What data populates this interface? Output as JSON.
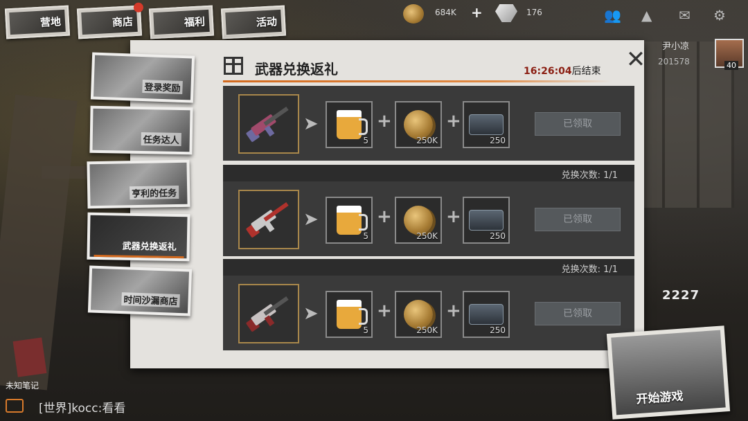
{
  "top_nav": [
    {
      "label": "营地",
      "badge": false
    },
    {
      "label": "商店",
      "badge": true
    },
    {
      "label": "福利",
      "badge": false
    },
    {
      "label": "活动",
      "badge": false
    }
  ],
  "resources": {
    "coins": "684K",
    "gems": "176"
  },
  "top_icons": [
    "friends-icon",
    "ranking-icon",
    "mail-icon",
    "settings-icon"
  ],
  "player": {
    "name": "尹小凉",
    "id": "201578",
    "level": "40",
    "power": "2227"
  },
  "side_menu": [
    {
      "label": "登录奖励",
      "active": false
    },
    {
      "label": "任务达人",
      "active": false
    },
    {
      "label": "亨利的任务",
      "active": false
    },
    {
      "label": "武器兑换返礼",
      "active": true
    },
    {
      "label": "时间沙漏商店",
      "active": false
    }
  ],
  "panel": {
    "title": "武器兑换返礼",
    "timer_value": "16:26:04",
    "timer_suffix": "后结束"
  },
  "rows": [
    {
      "count_label": "",
      "weapon": {
        "colors": [
          "#6d6aa0",
          "#a14a6b"
        ]
      },
      "rewards": [
        {
          "type": "beer",
          "qty": "5"
        },
        {
          "type": "coin",
          "qty": "250K"
        },
        {
          "type": "chest",
          "qty": "250"
        }
      ],
      "button": "已领取"
    },
    {
      "count_label": "兑换次数: 1/1",
      "weapon": {
        "colors": [
          "#c9c9c9",
          "#b0322c"
        ]
      },
      "rewards": [
        {
          "type": "beer",
          "qty": "5"
        },
        {
          "type": "coin",
          "qty": "250K"
        },
        {
          "type": "chest",
          "qty": "250"
        }
      ],
      "button": "已领取"
    },
    {
      "count_label": "兑换次数: 1/1",
      "weapon": {
        "colors": [
          "#c8c2c2",
          "#8a2a2a"
        ]
      },
      "rewards": [
        {
          "type": "beer",
          "qty": "5"
        },
        {
          "type": "coin",
          "qty": "250K"
        },
        {
          "type": "chest",
          "qty": "250"
        }
      ],
      "button": "已领取"
    }
  ],
  "bottom": {
    "notebook": "未知笔记",
    "chat": "[世界]kocc:看看",
    "start_button": "开始游戏"
  }
}
